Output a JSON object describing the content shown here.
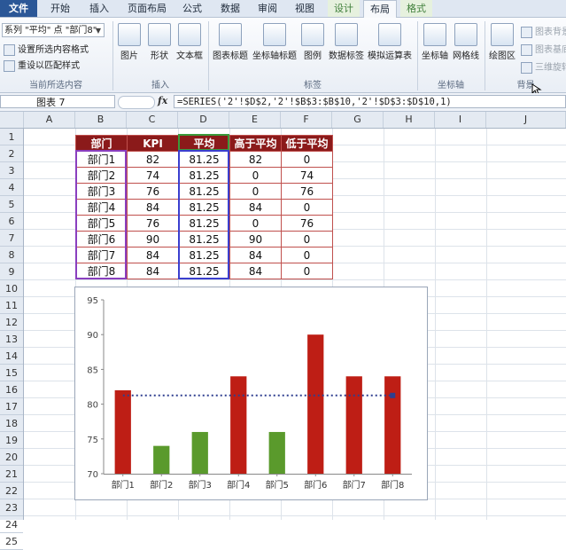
{
  "tabs": {
    "file": "文件",
    "home": "开始",
    "insert": "插入",
    "page_layout": "页面布局",
    "formulas": "公式",
    "data": "数据",
    "review": "审阅",
    "view": "视图",
    "design": "设计",
    "layout": "布局",
    "format": "格式"
  },
  "ribbon": {
    "selection_combo": "系列 \"平均\" 点 \"部门8\"",
    "format_selection": "设置所选内容格式",
    "reset_style": "重设以匹配样式",
    "group_current_selection": "当前所选内容",
    "picture": "图片",
    "shapes": "形状",
    "textbox": "文本框",
    "group_insert": "插入",
    "chart_title": "图表标题",
    "axis_titles": "坐标轴标题",
    "legend": "图例",
    "data_labels": "数据标签",
    "data_table": "模拟运算表",
    "group_labels": "标签",
    "axes": "坐标轴",
    "gridlines": "网格线",
    "group_axes": "坐标轴",
    "plot_area": "绘图区",
    "chart_wall": "图表背景",
    "chart_floor": "图表基底",
    "rotation_3d": "三维旋转",
    "group_background": "背景"
  },
  "formula_bar": {
    "name_box": "图表 7",
    "fx": "fx",
    "formula": "=SERIES('2'!$D$2,'2'!$B$3:$B$10,'2'!$D$3:$D$10,1)"
  },
  "columns": [
    "A",
    "B",
    "C",
    "D",
    "E",
    "F",
    "G",
    "H",
    "I",
    "J"
  ],
  "rows": [
    "1",
    "2",
    "3",
    "4",
    "5",
    "6",
    "7",
    "8",
    "9",
    "10",
    "11",
    "12",
    "13",
    "14",
    "15",
    "16",
    "17",
    "18",
    "19",
    "20",
    "21",
    "22",
    "23",
    "24",
    "25"
  ],
  "table": {
    "headers": [
      "部门",
      "KPI",
      "平均",
      "高于平均",
      "低于平均"
    ],
    "rows": [
      [
        "部门1",
        "82",
        "81.25",
        "82",
        "0"
      ],
      [
        "部门2",
        "74",
        "81.25",
        "0",
        "74"
      ],
      [
        "部门3",
        "76",
        "81.25",
        "0",
        "76"
      ],
      [
        "部门4",
        "84",
        "81.25",
        "84",
        "0"
      ],
      [
        "部门5",
        "76",
        "81.25",
        "0",
        "76"
      ],
      [
        "部门6",
        "90",
        "81.25",
        "90",
        "0"
      ],
      [
        "部门7",
        "84",
        "81.25",
        "84",
        "0"
      ],
      [
        "部门8",
        "84",
        "81.25",
        "84",
        "0"
      ]
    ]
  },
  "colors": {
    "above": "#be1e15",
    "below": "#5a9a2c",
    "average_line": "#2e3f8f",
    "header_fill": "#8b1a1a"
  },
  "chart_data": {
    "type": "bar",
    "categories": [
      "部门1",
      "部门2",
      "部门3",
      "部门4",
      "部门5",
      "部门6",
      "部门7",
      "部门8"
    ],
    "series": [
      {
        "name": "高于平均",
        "values": [
          82,
          0,
          0,
          84,
          0,
          90,
          84,
          84
        ]
      },
      {
        "name": "低于平均",
        "values": [
          0,
          74,
          76,
          0,
          76,
          0,
          0,
          0
        ]
      },
      {
        "name": "平均",
        "values": [
          81.25,
          81.25,
          81.25,
          81.25,
          81.25,
          81.25,
          81.25,
          81.25
        ],
        "style": "dotted-line"
      }
    ],
    "ylim": [
      70,
      95
    ],
    "yticks": [
      "70",
      "75",
      "80",
      "85",
      "90",
      "95"
    ],
    "title": "",
    "xlabel": "",
    "ylabel": "",
    "grid": false,
    "legend": "none"
  }
}
